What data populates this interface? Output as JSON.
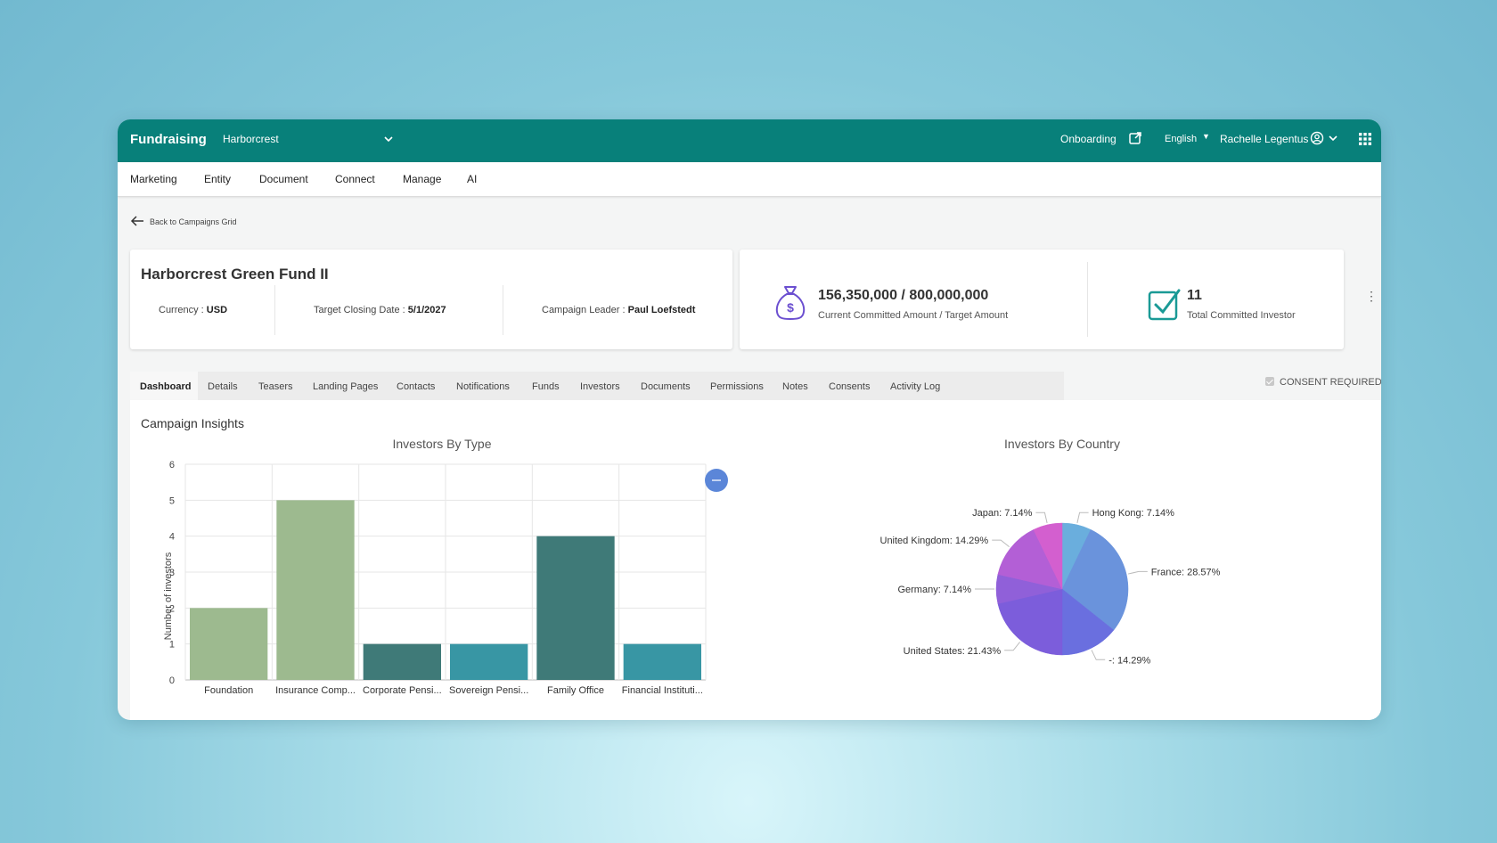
{
  "topbar": {
    "brand": "Fundraising",
    "entity": "Harborcrest",
    "onboarding": "Onboarding",
    "language": "English",
    "user": "Rachelle Legentus"
  },
  "nav": [
    "Marketing",
    "Entity",
    "Document",
    "Connect",
    "Manage",
    "AI"
  ],
  "back_label": "Back to Campaigns Grid",
  "fund": {
    "title": "Harborcrest Green Fund II",
    "currency_label": "Currency : ",
    "currency": "USD",
    "closing_label": "Target Closing Date : ",
    "closing": "5/1/2027",
    "leader_label": "Campaign Leader : ",
    "leader": "Paul Loefstedt"
  },
  "stats": {
    "amount": "156,350,000 / 800,000,000",
    "amount_label": "Current Committed Amount / Target Amount",
    "investors": "11",
    "investors_label": "Total Committed Investor"
  },
  "tabs": [
    "Dashboard",
    "Details",
    "Teasers",
    "Landing Pages",
    "Contacts",
    "Notifications",
    "Funds",
    "Investors",
    "Documents",
    "Permissions",
    "Notes",
    "Consents",
    "Activity Log"
  ],
  "consent_label": "CONSENT REQUIRED",
  "insights_title": "Campaign Insights",
  "icons": [
    "chevron-down-icon",
    "external-link-icon",
    "caret-down-icon",
    "user-circle-icon",
    "apps-grid-icon",
    "arrow-left-icon",
    "money-bag-icon",
    "checkbox-check-icon",
    "kebab-icon",
    "checkbox-icon",
    "minus-icon"
  ],
  "colors": {
    "primary": "#08807a",
    "bar_light": "#9dba8f",
    "bar_dark": "#3f7a78",
    "bar_teal": "#3896a4"
  },
  "chart_data": [
    {
      "type": "bar",
      "title": "Investors By Type",
      "ylabel": "Number of investors",
      "xlabel": "",
      "categories": [
        "Foundation",
        "Insurance Comp...",
        "Corporate Pensi...",
        "Sovereign Pensi...",
        "Family Office",
        "Financial Instituti..."
      ],
      "values": [
        2,
        5,
        1,
        1,
        4,
        1
      ],
      "colors": [
        "#9dba8f",
        "#9dba8f",
        "#3f7a78",
        "#3896a4",
        "#3f7a78",
        "#3896a4"
      ],
      "ylim": [
        0,
        6
      ],
      "yticks": [
        "0",
        "1",
        "2",
        "3",
        "4",
        "5",
        "6"
      ],
      "grid": true
    },
    {
      "type": "pie",
      "title": "Investors By Country",
      "slices": [
        {
          "label": "Hong Kong: 7.14%",
          "value": 7.14,
          "color": "#6aaedd"
        },
        {
          "label": "France: 28.57%",
          "value": 28.57,
          "color": "#6a93dc"
        },
        {
          "label": "-: 14.29%",
          "value": 14.29,
          "color": "#6a6fdf"
        },
        {
          "label": "United States: 21.43%",
          "value": 21.43,
          "color": "#7c5ddb"
        },
        {
          "label": "Germany: 7.14%",
          "value": 7.14,
          "color": "#9060d9"
        },
        {
          "label": "United Kingdom: 14.29%",
          "value": 14.29,
          "color": "#b35fd6"
        },
        {
          "label": "Japan: 7.14%",
          "value": 7.14,
          "color": "#d35fcf"
        }
      ]
    }
  ]
}
